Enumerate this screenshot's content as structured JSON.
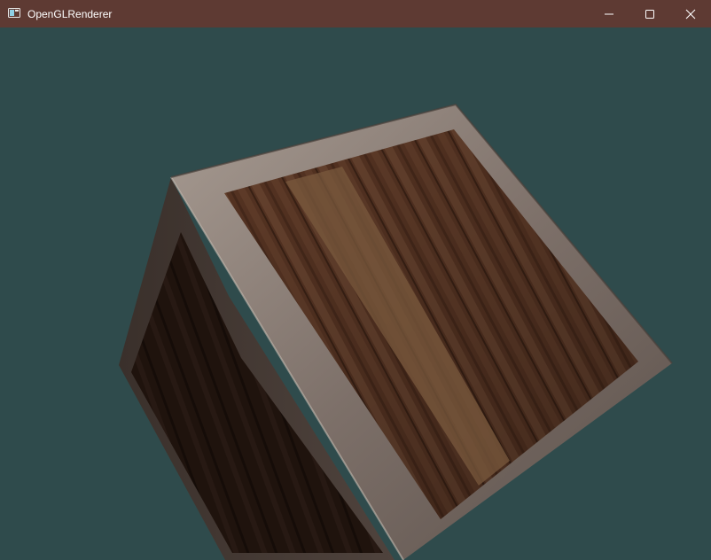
{
  "window": {
    "title": "OpenGLRenderer",
    "titlebar_color": "#5e3a33",
    "icon": "application-window-icon",
    "controls": {
      "minimize_icon": "minimize-icon",
      "maximize_icon": "maximize-icon",
      "close_icon": "close-icon"
    }
  },
  "viewport": {
    "clear_color": "#2f4f4f",
    "scene_object": "wooden-crate"
  }
}
